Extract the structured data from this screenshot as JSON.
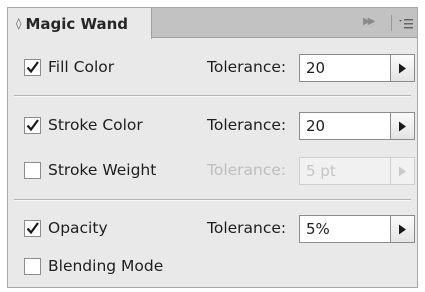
{
  "panel": {
    "tab_glyph": "◊",
    "title": "Magic Wand",
    "collapse_icon": "double-right-arrow-icon",
    "menu_icon": "panel-menu-icon"
  },
  "rows": [
    {
      "label": "Fill Color",
      "checked": true,
      "tolerance_label": "Tolerance:",
      "value": "20",
      "enabled": true
    },
    {
      "label": "Stroke Color",
      "checked": true,
      "tolerance_label": "Tolerance:",
      "value": "20",
      "enabled": true
    },
    {
      "label": "Stroke Weight",
      "checked": false,
      "tolerance_label": "Tolerance:",
      "value": "5 pt",
      "enabled": false
    },
    {
      "label": "Opacity",
      "checked": true,
      "tolerance_label": "Tolerance:",
      "value": "5%",
      "enabled": true
    },
    {
      "label": "Blending Mode",
      "checked": false
    }
  ]
}
